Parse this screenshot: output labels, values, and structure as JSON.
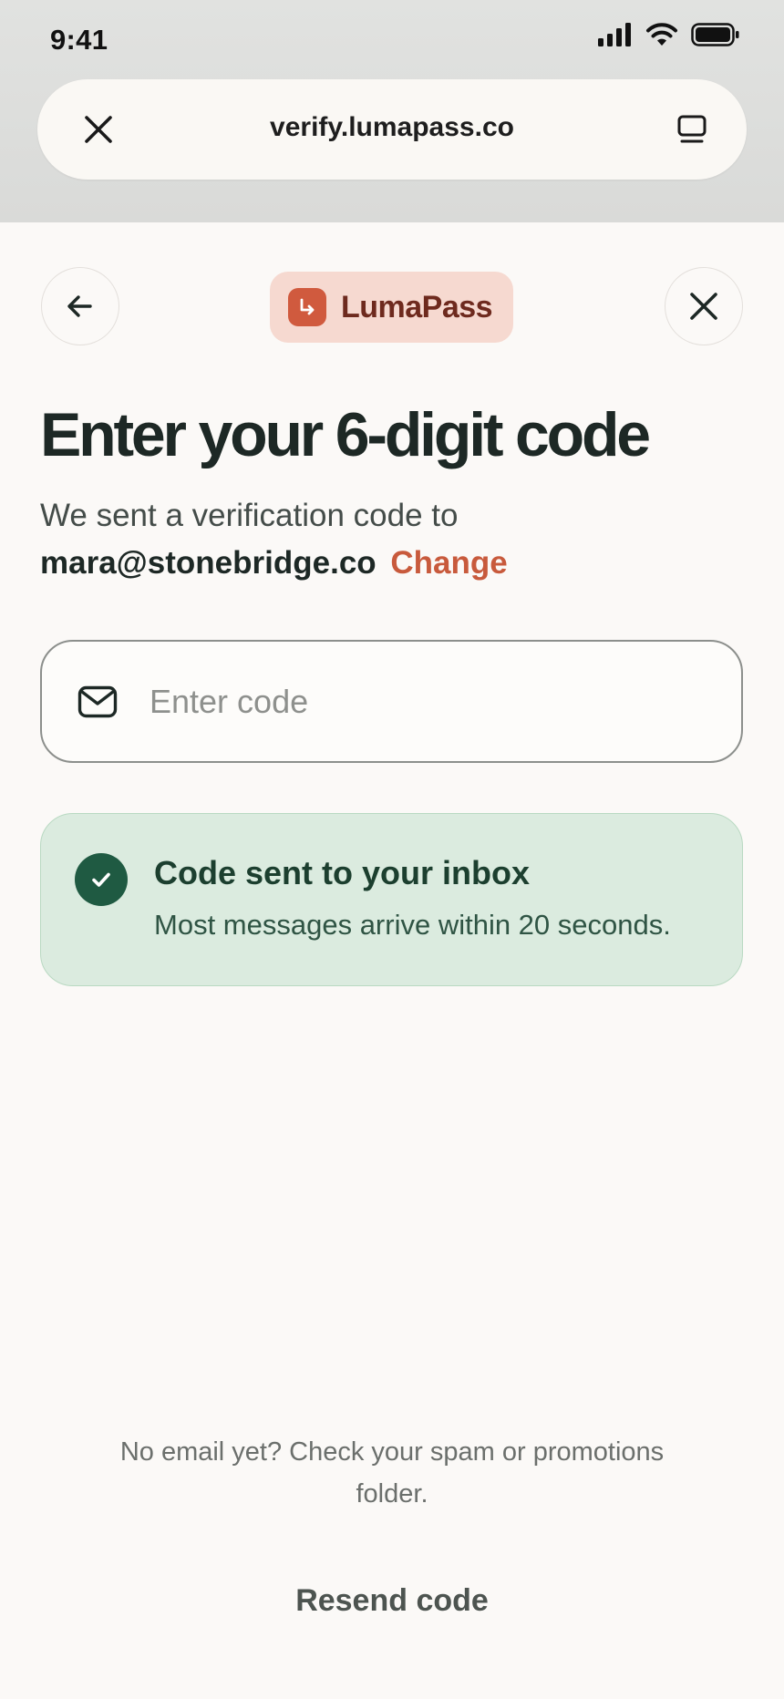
{
  "status_bar": {
    "time": "9:41"
  },
  "browser": {
    "url": "verify.lumapass.co"
  },
  "header": {
    "brand_name": "LumaPass"
  },
  "main": {
    "title": "Enter your 6-digit code",
    "subtitle": "We sent a verification code to",
    "email": "mara@stonebridge.co",
    "change_link": "Change",
    "code_input": {
      "placeholder": "Enter code",
      "value": ""
    },
    "banner": {
      "title": "Code sent to your inbox",
      "text": "Most messages arrive within 20 seconds."
    }
  },
  "footer": {
    "hint": "No email yet? Check your spam or promotions folder.",
    "resend_label": "Resend code"
  },
  "colors": {
    "brand": "#D05A3E",
    "brand_bg": "#F6D9D0",
    "success": "#1F5A42",
    "success_bg": "#DBEBDF",
    "link": "#C85A3C"
  }
}
